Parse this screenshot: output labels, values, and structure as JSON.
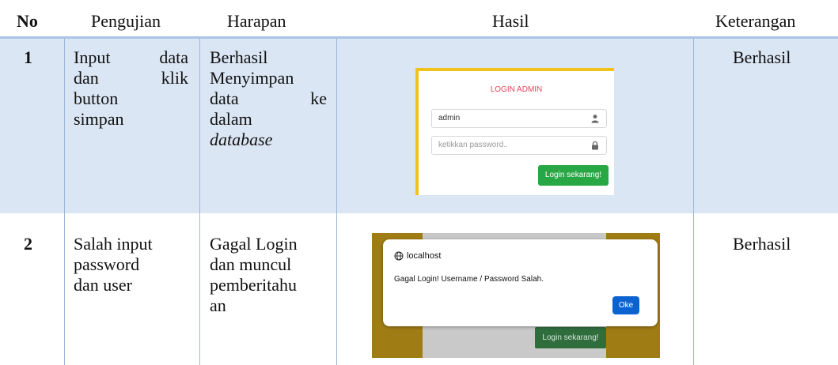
{
  "table": {
    "headers": [
      "No",
      "Pengujian",
      "Harapan",
      "Hasil",
      "Keterangan"
    ],
    "rows": [
      {
        "no": "1",
        "pengujian": [
          "Input",
          "data",
          "dan",
          "klik",
          "button",
          "simpan"
        ],
        "harapan": [
          "Berhasil",
          "Menyimpan",
          "data",
          "ke",
          "dalam",
          "database"
        ],
        "keterangan": "Berhasil"
      },
      {
        "no": "2",
        "pengujian": [
          "Salah input",
          "password",
          "dan user"
        ],
        "harapan": [
          "Gagal Login",
          "dan muncul",
          "pemberitahu",
          "an"
        ],
        "keterangan": "Berhasil"
      }
    ]
  },
  "login_screenshot": {
    "title": "LOGIN ADMIN",
    "username_value": "admin",
    "password_placeholder": "ketikkan password..",
    "login_button": "Login sekarang!",
    "accent_color": "#f1c21b",
    "title_color": "#e0465d",
    "button_color": "#28a745",
    "icons": [
      "user-icon",
      "lock-icon"
    ]
  },
  "alert_screenshot": {
    "host": "localhost",
    "message": "Gagal Login! Username / Password Salah.",
    "ok_button": "Oke",
    "background_button": "Login sekarang!",
    "icons": [
      "globe-icon"
    ]
  }
}
